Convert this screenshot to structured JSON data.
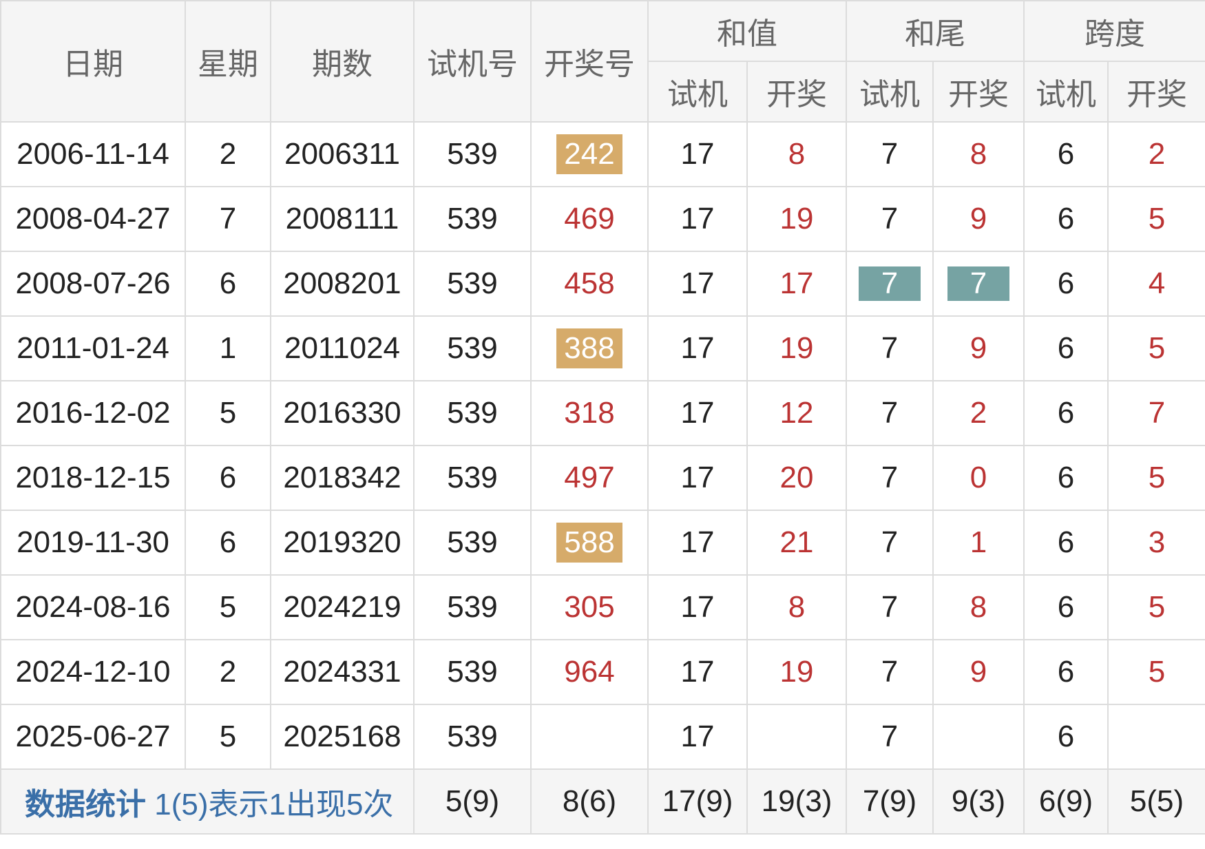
{
  "header": {
    "date": "日期",
    "weekday": "星期",
    "issue": "期数",
    "test_number": "试机号",
    "draw_number": "开奖号",
    "sum_group": "和值",
    "tail_group": "和尾",
    "span_group": "跨度",
    "sub_test": "试机",
    "sub_draw": "开奖"
  },
  "rows": [
    {
      "date": "2006-11-14",
      "weekday": "2",
      "issue": "2006311",
      "test": "539",
      "draw": "242",
      "draw_hl": true,
      "sum_test": "17",
      "sum_draw": "8",
      "tail_test": "7",
      "tail_draw": "8",
      "tail_hl": false,
      "span_test": "6",
      "span_draw": "2"
    },
    {
      "date": "2008-04-27",
      "weekday": "7",
      "issue": "2008111",
      "test": "539",
      "draw": "469",
      "draw_hl": false,
      "sum_test": "17",
      "sum_draw": "19",
      "tail_test": "7",
      "tail_draw": "9",
      "tail_hl": false,
      "span_test": "6",
      "span_draw": "5"
    },
    {
      "date": "2008-07-26",
      "weekday": "6",
      "issue": "2008201",
      "test": "539",
      "draw": "458",
      "draw_hl": false,
      "sum_test": "17",
      "sum_draw": "17",
      "tail_test": "7",
      "tail_draw": "7",
      "tail_hl": true,
      "span_test": "6",
      "span_draw": "4"
    },
    {
      "date": "2011-01-24",
      "weekday": "1",
      "issue": "2011024",
      "test": "539",
      "draw": "388",
      "draw_hl": true,
      "sum_test": "17",
      "sum_draw": "19",
      "tail_test": "7",
      "tail_draw": "9",
      "tail_hl": false,
      "span_test": "6",
      "span_draw": "5"
    },
    {
      "date": "2016-12-02",
      "weekday": "5",
      "issue": "2016330",
      "test": "539",
      "draw": "318",
      "draw_hl": false,
      "sum_test": "17",
      "sum_draw": "12",
      "tail_test": "7",
      "tail_draw": "2",
      "tail_hl": false,
      "span_test": "6",
      "span_draw": "7"
    },
    {
      "date": "2018-12-15",
      "weekday": "6",
      "issue": "2018342",
      "test": "539",
      "draw": "497",
      "draw_hl": false,
      "sum_test": "17",
      "sum_draw": "20",
      "tail_test": "7",
      "tail_draw": "0",
      "tail_hl": false,
      "span_test": "6",
      "span_draw": "5"
    },
    {
      "date": "2019-11-30",
      "weekday": "6",
      "issue": "2019320",
      "test": "539",
      "draw": "588",
      "draw_hl": true,
      "sum_test": "17",
      "sum_draw": "21",
      "tail_test": "7",
      "tail_draw": "1",
      "tail_hl": false,
      "span_test": "6",
      "span_draw": "3"
    },
    {
      "date": "2024-08-16",
      "weekday": "5",
      "issue": "2024219",
      "test": "539",
      "draw": "305",
      "draw_hl": false,
      "sum_test": "17",
      "sum_draw": "8",
      "tail_test": "7",
      "tail_draw": "8",
      "tail_hl": false,
      "span_test": "6",
      "span_draw": "5"
    },
    {
      "date": "2024-12-10",
      "weekday": "2",
      "issue": "2024331",
      "test": "539",
      "draw": "964",
      "draw_hl": false,
      "sum_test": "17",
      "sum_draw": "19",
      "tail_test": "7",
      "tail_draw": "9",
      "tail_hl": false,
      "span_test": "6",
      "span_draw": "5"
    },
    {
      "date": "2025-06-27",
      "weekday": "5",
      "issue": "2025168",
      "test": "539",
      "draw": "",
      "draw_hl": false,
      "sum_test": "17",
      "sum_draw": "",
      "tail_test": "7",
      "tail_draw": "",
      "tail_hl": false,
      "span_test": "6",
      "span_draw": ""
    }
  ],
  "stats": {
    "label": "数据统计",
    "note": "1(5)表示1出现5次",
    "test": "5(9)",
    "draw": "8(6)",
    "sum_test": "17(9)",
    "sum_draw": "19(3)",
    "tail_test": "7(9)",
    "tail_draw": "9(3)",
    "span_test": "6(9)",
    "span_draw": "5(5)"
  },
  "colors": {
    "header_bg": "#f5f5f5",
    "draw_text": "#bb3333",
    "gold_highlight": "#d6ab6a",
    "teal_highlight": "#76a3a3",
    "stat_text": "#3a6fa8"
  }
}
